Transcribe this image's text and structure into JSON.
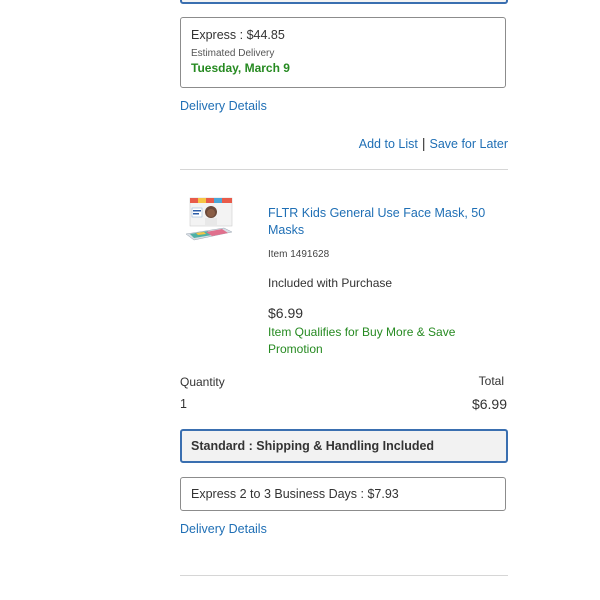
{
  "shipping_option_1": {
    "express_label": "Express : $44.85",
    "estimated_label": "Estimated Delivery",
    "estimated_date": "Tuesday, March 9"
  },
  "delivery_details_1": "Delivery Details",
  "list_actions": {
    "add_to_list": "Add to List",
    "separator": "|",
    "save_for_later": "Save for Later"
  },
  "product": {
    "title": "FLTR Kids General Use Face Mask, 50 Masks",
    "item_number": "Item 1491628",
    "included": "Included with Purchase",
    "price": "$6.99",
    "promotion": "Item Qualifies for Buy More & Save Promotion",
    "quantity_label": "Quantity",
    "quantity_value": "1",
    "total_label": "Total",
    "total_value": "$6.99"
  },
  "shipping_option_2": {
    "standard_label": "Standard : Shipping & Handling Included",
    "express_label": "Express 2 to 3 Business Days : $7.93"
  },
  "delivery_details_2": "Delivery Details",
  "colors": {
    "link": "#1f6fb5",
    "promo_green": "#268a21",
    "selected_border": "#3a6fb0"
  }
}
